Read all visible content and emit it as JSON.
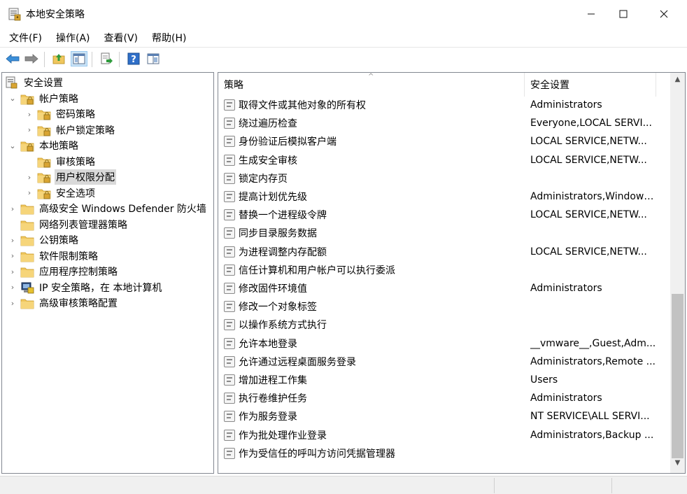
{
  "window": {
    "title": "本地安全策略",
    "min_glyph": "—",
    "max_glyph": "☐",
    "close_glyph": "✕"
  },
  "menu": [
    "文件(F)",
    "操作(A)",
    "查看(V)",
    "帮助(H)"
  ],
  "toolbar": {
    "buttons": [
      "back-icon",
      "forward-icon",
      "up-folder-icon",
      "show-hide-tree-icon",
      "export-list-icon",
      "help-icon",
      "properties-icon"
    ]
  },
  "tree": {
    "items": [
      {
        "label": "安全设置",
        "level": 0,
        "expander": "",
        "icon": "security-settings-icon"
      },
      {
        "label": "帐户策略",
        "level": 1,
        "expander": "expanded",
        "icon": "folder-lock-icon"
      },
      {
        "label": "密码策略",
        "level": 2,
        "expander": "collapsed",
        "icon": "folder-lock-icon"
      },
      {
        "label": "帐户锁定策略",
        "level": 2,
        "expander": "collapsed",
        "icon": "folder-lock-icon"
      },
      {
        "label": "本地策略",
        "level": 1,
        "expander": "expanded",
        "icon": "folder-lock-icon"
      },
      {
        "label": "审核策略",
        "level": 2,
        "expander": "",
        "icon": "folder-lock-icon"
      },
      {
        "label": "用户权限分配",
        "level": 2,
        "expander": "collapsed",
        "icon": "folder-lock-icon",
        "selected": true
      },
      {
        "label": "安全选项",
        "level": 2,
        "expander": "collapsed",
        "icon": "folder-lock-icon"
      },
      {
        "label": "高级安全 Windows Defender 防火墙",
        "level": 1,
        "expander": "collapsed",
        "icon": "folder-icon"
      },
      {
        "label": "网络列表管理器策略",
        "level": 1,
        "expander": "",
        "icon": "folder-icon"
      },
      {
        "label": "公钥策略",
        "level": 1,
        "expander": "collapsed",
        "icon": "folder-icon"
      },
      {
        "label": "软件限制策略",
        "level": 1,
        "expander": "collapsed",
        "icon": "folder-icon"
      },
      {
        "label": "应用程序控制策略",
        "level": 1,
        "expander": "collapsed",
        "icon": "folder-icon"
      },
      {
        "label": "IP 安全策略，在 本地计算机",
        "level": 1,
        "expander": "collapsed",
        "icon": "ip-security-icon"
      },
      {
        "label": "高级审核策略配置",
        "level": 1,
        "expander": "collapsed",
        "icon": "folder-icon"
      }
    ]
  },
  "list": {
    "col_policy": "策略",
    "col_setting": "安全设置",
    "sort_indicator": "^",
    "rows": [
      {
        "policy": "取得文件或其他对象的所有权",
        "setting": "Administrators"
      },
      {
        "policy": "绕过遍历检查",
        "setting": "Everyone,LOCAL SERVI..."
      },
      {
        "policy": "身份验证后模拟客户端",
        "setting": "LOCAL SERVICE,NETW..."
      },
      {
        "policy": "生成安全审核",
        "setting": "LOCAL SERVICE,NETW..."
      },
      {
        "policy": "锁定内存页",
        "setting": ""
      },
      {
        "policy": "提高计划优先级",
        "setting": "Administrators,Window ..."
      },
      {
        "policy": "替换一个进程级令牌",
        "setting": "LOCAL SERVICE,NETW..."
      },
      {
        "policy": "同步目录服务数据",
        "setting": ""
      },
      {
        "policy": "为进程调整内存配额",
        "setting": "LOCAL SERVICE,NETW..."
      },
      {
        "policy": "信任计算机和用户帐户可以执行委派",
        "setting": ""
      },
      {
        "policy": "修改固件环境值",
        "setting": "Administrators"
      },
      {
        "policy": "修改一个对象标签",
        "setting": ""
      },
      {
        "policy": "以操作系统方式执行",
        "setting": ""
      },
      {
        "policy": "允许本地登录",
        "setting": "__vmware__,Guest,Adm..."
      },
      {
        "policy": "允许通过远程桌面服务登录",
        "setting": "Administrators,Remote ..."
      },
      {
        "policy": "增加进程工作集",
        "setting": "Users"
      },
      {
        "policy": "执行卷维护任务",
        "setting": "Administrators"
      },
      {
        "policy": "作为服务登录",
        "setting": "NT SERVICE\\ALL SERVI..."
      },
      {
        "policy": "作为批处理作业登录",
        "setting": "Administrators,Backup ..."
      },
      {
        "policy": "作为受信任的呼叫方访问凭据管理器",
        "setting": ""
      }
    ]
  },
  "scrollbar": {
    "up_glyph": "▲",
    "down_glyph": "▼",
    "scroll_position_fraction": 0.55
  },
  "colors": {
    "tree_selected": "#d9d9d9",
    "folder": "#f0c75e",
    "toolbar_active": "#cce4f7"
  }
}
